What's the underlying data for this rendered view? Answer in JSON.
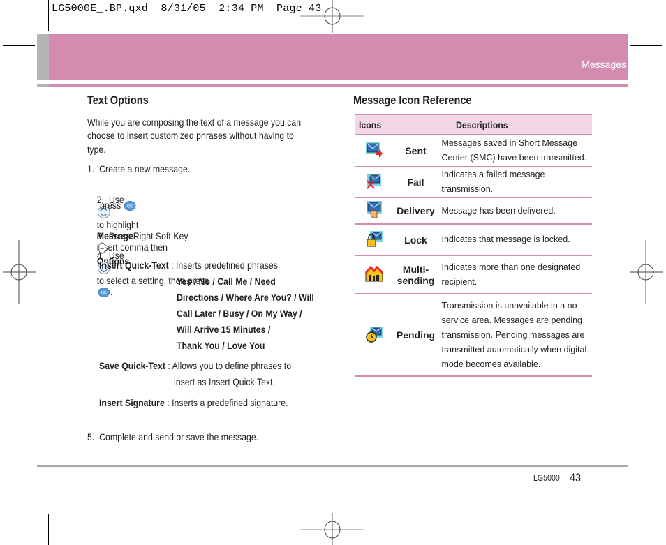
{
  "slug": "LG5000E_.BP.qxd  8/31/05  2:34 PM  Page 43",
  "header": {
    "section": "Messages"
  },
  "colors": {
    "accent": "#d48bb0",
    "accent_light": "#f2d8e6",
    "side_tab": "#b5b5b5",
    "footer_rule": "#a8a8a8"
  },
  "left": {
    "title": "Text Options",
    "intro": [
      "While you are composing the text of a message you can",
      "choose to insert customized phrases without having to",
      "type."
    ],
    "step1": "1.  Create a new message.",
    "step2": {
      "a": "2.  Use",
      "b": "to highlight",
      "bold": "Message",
      "c": "insert comma then",
      "d": "press",
      "e": "."
    },
    "step3": {
      "a": "3.  Press Right Soft Key",
      "bold": "Options",
      "e": "."
    },
    "step4": {
      "a": "4.  Use",
      "b": "to select a setting, then press",
      "e": "."
    },
    "insert_quick": {
      "label": "Insert Quick-Text",
      "sep": " : ",
      "desc": "Inserts predefined phrases.",
      "phrases": [
        "Yes / No / Call Me / Need",
        "Directions / Where Are You? / Will",
        "Call Later / Busy / On My Way /",
        "Will Arrive 15 Minutes /",
        "Thank You / Love You"
      ]
    },
    "save_quick": {
      "label": "Save Quick-Text",
      "sep": " : ",
      "desc1": "Allows you to define phrases to",
      "desc2": "insert as Insert Quick Text."
    },
    "insert_sig": {
      "label": "Insert Signature",
      "sep": " : ",
      "desc": "Inserts a predefined signature."
    },
    "step5": "5.  Complete and send or save the message."
  },
  "right": {
    "title": "Message Icon Reference",
    "headers": {
      "icons": "Icons",
      "descriptions": "Descriptions"
    },
    "rows": [
      {
        "icon": "sent-icon",
        "name": "Sent",
        "desc": "Messages saved in Short Message Center (SMC) have been transmitted."
      },
      {
        "icon": "fail-icon",
        "name": "Fail",
        "desc": "Indicates a failed message transmission."
      },
      {
        "icon": "delivery-icon",
        "name": "Delivery",
        "desc": "Message has been delivered."
      },
      {
        "icon": "lock-icon",
        "name": "Lock",
        "desc": "Indicates that message is locked."
      },
      {
        "icon": "multi-sending-icon",
        "name": "Multi-\nsending",
        "desc": "Indicates more than one designated recipient."
      },
      {
        "icon": "pending-icon",
        "name": "Pending",
        "desc": "Transmission is unavailable in a no service area. Messages are pending transmission. Pending messages are transmitted automatically when digital mode becomes available."
      }
    ]
  },
  "footer": {
    "model": "LG5000",
    "page": "43"
  }
}
